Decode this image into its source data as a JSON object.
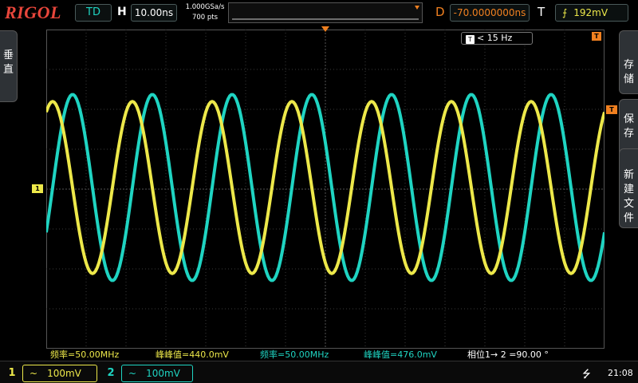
{
  "topbar": {
    "brand": "RIGOL",
    "run_state": "TD",
    "timebase_label": "H",
    "timebase_value": "10.00ns",
    "sample_rate": "1.000GSa/s",
    "memory_depth": "700  pts",
    "delay_label": "D",
    "delay_value": "-70.0000000ns",
    "trigger_label": "T",
    "trigger_icon": "rising-edge-icon",
    "trigger_level": "192mV"
  },
  "left_menu": {
    "chars": [
      "垂",
      "直"
    ]
  },
  "right_menu": [
    {
      "chars": [
        "存",
        "储"
      ]
    },
    {
      "chars": [
        "保",
        "存"
      ]
    },
    {
      "chars": [
        "新",
        "建",
        "文",
        "件"
      ]
    }
  ],
  "filter_badge": "< 15 Hz",
  "markers": {
    "ch1": "1",
    "trigger_level": "T",
    "trigger_pos": "T"
  },
  "measurements": [
    {
      "text": "频率=50.00MHz",
      "color": "#ede84a"
    },
    {
      "text": "峰峰值=440.0mV",
      "color": "#ede84a"
    },
    {
      "text": "频率=50.00MHz",
      "color": "#1fd4c2"
    },
    {
      "text": "峰峰值=476.0mV",
      "color": "#1fd4c2"
    },
    {
      "text": "相位1→ 2 =90.00 °",
      "color": "#ffffff"
    }
  ],
  "channels": [
    {
      "num": "1",
      "coupling": "~",
      "scale": "100mV",
      "color": "#ede84a"
    },
    {
      "num": "2",
      "coupling": "~",
      "scale": "100mV",
      "color": "#1fd4c2"
    }
  ],
  "status": {
    "usb_icon": "usb-icon",
    "time": "21:08"
  },
  "waveforms": {
    "ch1_color": "#ede84a",
    "ch2_color": "#1fd4c2",
    "frequency_mhz": 50,
    "ch1_vpp_mv": 440,
    "ch2_vpp_mv": 476,
    "phase_deg": 90,
    "volts_per_div_mv": 100,
    "time_per_div_ns": 10
  }
}
